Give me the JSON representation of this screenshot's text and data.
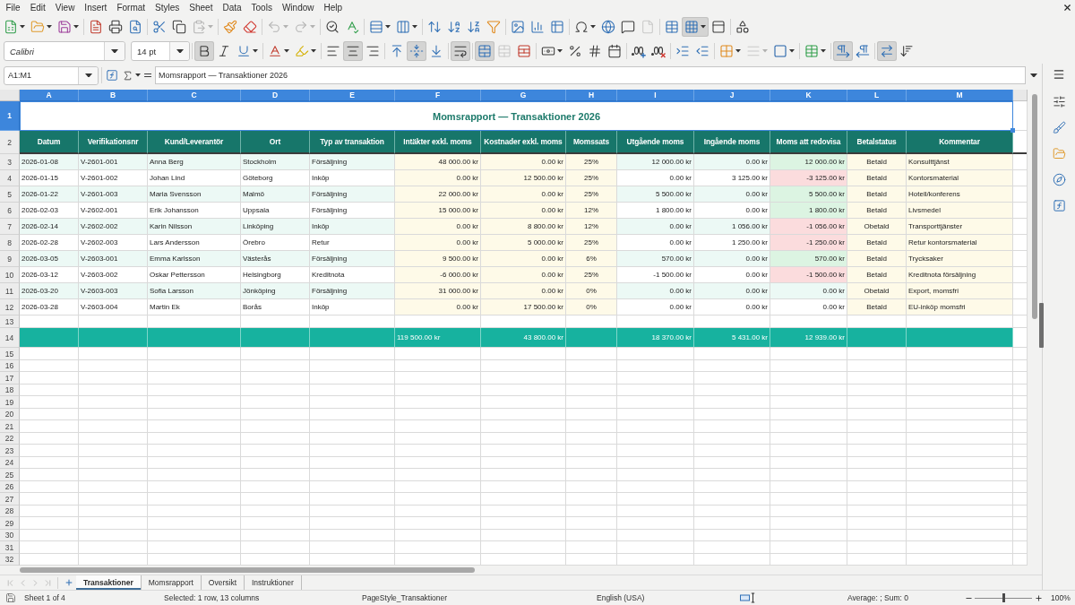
{
  "menu_bar": {
    "items": [
      "File",
      "Edit",
      "View",
      "Insert",
      "Format",
      "Styles",
      "Sheet",
      "Data",
      "Tools",
      "Window",
      "Help"
    ]
  },
  "standard_toolbar": [
    {
      "on": false,
      "disabled": false
    },
    {
      "on": false,
      "disabled": false
    },
    {
      "on": false,
      "disabled": false
    },
    {
      "on": false,
      "disabled": false
    },
    {
      "on": false,
      "disabled": false
    },
    {
      "on": false,
      "disabled": false
    },
    {
      "on": false,
      "disabled": false
    },
    {
      "on": false,
      "disabled": false
    },
    {
      "on": false,
      "disabled": true
    },
    {
      "on": false,
      "disabled": false
    },
    {
      "on": false,
      "disabled": false
    },
    {
      "on": false,
      "disabled": true
    },
    {
      "on": false,
      "disabled": true
    },
    {
      "on": false,
      "disabled": false
    },
    {
      "on": false,
      "disabled": false
    },
    {
      "on": false,
      "disabled": false
    },
    {
      "on": false,
      "disabled": false
    },
    {
      "on": false,
      "disabled": false
    },
    {
      "on": false,
      "disabled": false
    },
    {
      "on": false,
      "disabled": false
    },
    {
      "on": false,
      "disabled": false
    },
    {
      "on": false,
      "disabled": false
    },
    {
      "on": false,
      "disabled": false
    },
    {
      "on": false,
      "disabled": false
    },
    {
      "on": false,
      "disabled": false
    },
    {
      "on": false,
      "disabled": false
    },
    {
      "on": false,
      "disabled": false
    },
    {
      "on": false,
      "disabled": true
    },
    {
      "on": false,
      "disabled": false
    },
    {
      "on": true,
      "disabled": false
    },
    {
      "on": false,
      "disabled": false
    },
    {
      "on": false,
      "disabled": false
    }
  ],
  "formatting_toolbar": {
    "font_name": "Calibri",
    "font_size": "14 pt",
    "buttons": [
      {
        "on": true,
        "disabled": false
      },
      {
        "on": false,
        "disabled": false
      },
      {
        "on": false,
        "disabled": false
      },
      {
        "on": false,
        "disabled": false
      },
      {
        "on": false,
        "disabled": false
      },
      {
        "on": false,
        "disabled": false
      },
      {
        "on": true,
        "disabled": false
      },
      {
        "on": false,
        "disabled": false
      },
      {
        "on": false,
        "disabled": false
      },
      {
        "on": true,
        "disabled": false
      },
      {
        "on": false,
        "disabled": false
      },
      {
        "on": true,
        "disabled": false
      },
      {
        "on": true,
        "disabled": false
      },
      {
        "on": false,
        "disabled": true
      },
      {
        "on": false,
        "disabled": false
      },
      {
        "on": false,
        "disabled": false
      },
      {
        "on": false,
        "disabled": false
      },
      {
        "on": false,
        "disabled": false
      },
      {
        "on": false,
        "disabled": false
      },
      {
        "on": false,
        "disabled": false
      },
      {
        "on": false,
        "disabled": false
      },
      {
        "on": false,
        "disabled": false
      },
      {
        "on": false,
        "disabled": false
      },
      {
        "on": false,
        "disabled": false
      },
      {
        "on": false,
        "disabled": true
      },
      {
        "on": false,
        "disabled": false
      },
      {
        "on": false,
        "disabled": false
      },
      {
        "on": true,
        "disabled": false
      },
      {
        "on": false,
        "disabled": false
      },
      {
        "on": true,
        "disabled": false
      },
      {
        "on": false,
        "disabled": false
      }
    ]
  },
  "formula_bar": {
    "name_box": "A1:M1",
    "content": "Momsrapport — Transaktioner 2026"
  },
  "sheet": {
    "column_letters": [
      {
        "label": "A",
        "selected": true
      },
      {
        "label": "B",
        "selected": true
      },
      {
        "label": "C",
        "selected": true
      },
      {
        "label": "D",
        "selected": true
      },
      {
        "label": "E",
        "selected": true
      },
      {
        "label": "F",
        "selected": true
      },
      {
        "label": "G",
        "selected": true
      },
      {
        "label": "H",
        "selected": true
      },
      {
        "label": "I",
        "selected": true
      },
      {
        "label": "J",
        "selected": true
      },
      {
        "label": "K",
        "selected": true
      },
      {
        "label": "L",
        "selected": true
      },
      {
        "label": "M",
        "selected": true
      }
    ],
    "row_numbers": [
      {
        "label": "1",
        "selected": true
      },
      {
        "label": "2",
        "selected": false
      },
      {
        "label": "3",
        "selected": false
      },
      {
        "label": "4",
        "selected": false
      },
      {
        "label": "5",
        "selected": false
      },
      {
        "label": "6",
        "selected": false
      },
      {
        "label": "7",
        "selected": false
      },
      {
        "label": "8",
        "selected": false
      },
      {
        "label": "9",
        "selected": false
      },
      {
        "label": "10",
        "selected": false
      },
      {
        "label": "11",
        "selected": false
      },
      {
        "label": "12",
        "selected": false
      },
      {
        "label": "13",
        "selected": false
      },
      {
        "label": "14",
        "selected": false
      },
      {
        "label": "15",
        "selected": false
      },
      {
        "label": "16",
        "selected": false
      },
      {
        "label": "17",
        "selected": false
      },
      {
        "label": "18",
        "selected": false
      },
      {
        "label": "19",
        "selected": false
      },
      {
        "label": "20",
        "selected": false
      },
      {
        "label": "21",
        "selected": false
      },
      {
        "label": "22",
        "selected": false
      },
      {
        "label": "23",
        "selected": false
      },
      {
        "label": "24",
        "selected": false
      },
      {
        "label": "25",
        "selected": false
      },
      {
        "label": "26",
        "selected": false
      },
      {
        "label": "27",
        "selected": false
      },
      {
        "label": "28",
        "selected": false
      },
      {
        "label": "29",
        "selected": false
      },
      {
        "label": "30",
        "selected": false
      },
      {
        "label": "31",
        "selected": false
      },
      {
        "label": "32",
        "selected": false
      }
    ],
    "title": "Momsrapport — Transaktioner 2026",
    "columns": [
      "Datum",
      "Verifikationsnr",
      "Kund/Leverantör",
      "Ort",
      "Typ av transaktion",
      "Intäkter exkl. moms",
      "Kostnader exkl. moms",
      "Momssats",
      "Utgående moms",
      "Ingående moms",
      "Moms att redovisa",
      "Betalstatus",
      "Kommentar"
    ],
    "rows": [
      {
        "date": "2026-01-08",
        "voucher_no": "V-2601-001",
        "party": "Anna Berg",
        "city": "Stockholm",
        "transaction_type": "Försäljning",
        "income_excl_vat": "48 000.00 kr",
        "costs_excl_vat": "0.00 kr",
        "vat_rate": "25%",
        "output_vat": "12 000.00 kr",
        "input_vat": "0.00 kr",
        "vat_to_report": {
          "value": "12 000.00 kr",
          "color": "#dcf4e2"
        },
        "payment_status": "Betald",
        "comment": "Konsulttjänst"
      },
      {
        "date": "2026-01-15",
        "voucher_no": "V-2601-002",
        "party": "Johan Lind",
        "city": "Göteborg",
        "transaction_type": "Inköp",
        "income_excl_vat": "0.00 kr",
        "costs_excl_vat": "12 500.00 kr",
        "vat_rate": "25%",
        "output_vat": "0.00 kr",
        "input_vat": "3 125.00 kr",
        "vat_to_report": {
          "value": "-3 125.00 kr",
          "color": "#fbdcdd"
        },
        "payment_status": "Betald",
        "comment": "Kontorsmaterial"
      },
      {
        "date": "2026-01-22",
        "voucher_no": "V-2601-003",
        "party": "Maria Svensson",
        "city": "Malmö",
        "transaction_type": "Försäljning",
        "income_excl_vat": "22 000.00 kr",
        "costs_excl_vat": "0.00 kr",
        "vat_rate": "25%",
        "output_vat": "5 500.00 kr",
        "input_vat": "0.00 kr",
        "vat_to_report": {
          "value": "5 500.00 kr",
          "color": "#dcf4e2"
        },
        "payment_status": "Betald",
        "comment": "Hotell/konferens"
      },
      {
        "date": "2026-02-03",
        "voucher_no": "V-2602-001",
        "party": "Erik Johansson",
        "city": "Uppsala",
        "transaction_type": "Försäljning",
        "income_excl_vat": "15 000.00 kr",
        "costs_excl_vat": "0.00 kr",
        "vat_rate": "12%",
        "output_vat": "1 800.00 kr",
        "input_vat": "0.00 kr",
        "vat_to_report": {
          "value": "1 800.00 kr",
          "color": "#dcf4e2"
        },
        "payment_status": "Betald",
        "comment": "Livsmedel"
      },
      {
        "date": "2026-02-14",
        "voucher_no": "V-2602-002",
        "party": "Karin Nilsson",
        "city": "Linköping",
        "transaction_type": "Inköp",
        "income_excl_vat": "0.00 kr",
        "costs_excl_vat": "8 800.00 kr",
        "vat_rate": "12%",
        "output_vat": "0.00 kr",
        "input_vat": "1 056.00 kr",
        "vat_to_report": {
          "value": "-1 056.00 kr",
          "color": "#fbdcdd"
        },
        "payment_status": "Obetald",
        "comment": "Transporttjänster"
      },
      {
        "date": "2026-02-28",
        "voucher_no": "V-2602-003",
        "party": "Lars Andersson",
        "city": "Örebro",
        "transaction_type": "Retur",
        "income_excl_vat": "0.00 kr",
        "costs_excl_vat": "5 000.00 kr",
        "vat_rate": "25%",
        "output_vat": "0.00 kr",
        "input_vat": "1 250.00 kr",
        "vat_to_report": {
          "value": "-1 250.00 kr",
          "color": "#fbdcdd"
        },
        "payment_status": "Betald",
        "comment": "Retur kontorsmaterial"
      },
      {
        "date": "2026-03-05",
        "voucher_no": "V-2603-001",
        "party": "Emma Karlsson",
        "city": "Västerås",
        "transaction_type": "Försäljning",
        "income_excl_vat": "9 500.00 kr",
        "costs_excl_vat": "0.00 kr",
        "vat_rate": "6%",
        "output_vat": "570.00 kr",
        "input_vat": "0.00 kr",
        "vat_to_report": {
          "value": "570.00 kr",
          "color": "#dcf4e2"
        },
        "payment_status": "Betald",
        "comment": "Trycksaker"
      },
      {
        "date": "2026-03-12",
        "voucher_no": "V-2603-002",
        "party": "Oskar Pettersson",
        "city": "Helsingborg",
        "transaction_type": "Kreditnota",
        "income_excl_vat": "-6 000.00 kr",
        "costs_excl_vat": "0.00 kr",
        "vat_rate": "25%",
        "output_vat": "-1 500.00 kr",
        "input_vat": "0.00 kr",
        "vat_to_report": {
          "value": "-1 500.00 kr",
          "color": "#fbdcdd"
        },
        "payment_status": "Betald",
        "comment": "Kreditnota försäljning"
      },
      {
        "date": "2026-03-20",
        "voucher_no": "V-2603-003",
        "party": "Sofia Larsson",
        "city": "Jönköping",
        "transaction_type": "Försäljning",
        "income_excl_vat": "31 000.00 kr",
        "costs_excl_vat": "0.00 kr",
        "vat_rate": "0%",
        "output_vat": "0.00 kr",
        "input_vat": "0.00 kr",
        "vat_to_report": {
          "value": "0.00 kr"
        },
        "payment_status": "Obetald",
        "comment": "Export, momsfri"
      },
      {
        "date": "2026-03-28",
        "voucher_no": "V-2603-004",
        "party": "Martin Ek",
        "city": "Borås",
        "transaction_type": "Inköp",
        "income_excl_vat": "0.00 kr",
        "costs_excl_vat": "17 500.00 kr",
        "vat_rate": "0%",
        "output_vat": "0.00 kr",
        "input_vat": "0.00 kr",
        "vat_to_report": {
          "value": "0.00 kr"
        },
        "payment_status": "Betald",
        "comment": "EU-inköp momsfri"
      }
    ],
    "totals": {
      "income_excl_vat": "119 500.00 kr",
      "costs_excl_vat": "43 800.00 kr",
      "output_vat": "18 370.00 kr",
      "input_vat": "5 431.00 kr",
      "vat_to_report": "12 939.00 kr"
    }
  },
  "sheet_navigation": [
    {
      "disabled": true
    },
    {
      "disabled": true
    },
    {
      "disabled": true
    },
    {
      "disabled": true
    }
  ],
  "sheet_tabs": [
    {
      "label": "Transaktioner",
      "selected": true
    },
    {
      "label": "Momsrapport",
      "selected": false
    },
    {
      "label": "Oversikt",
      "selected": false
    },
    {
      "label": "Instruktioner",
      "selected": false
    }
  ],
  "status_bar": {
    "sheet": "Sheet 1 of 4",
    "selection": "Selected: 1 row, 13 columns",
    "page_style": "PageStyle_Transaktioner",
    "language": "English (USA)",
    "summary": "Average: ; Sum: 0",
    "zoom": {
      "level": 0.5,
      "reading": "100%"
    }
  }
}
